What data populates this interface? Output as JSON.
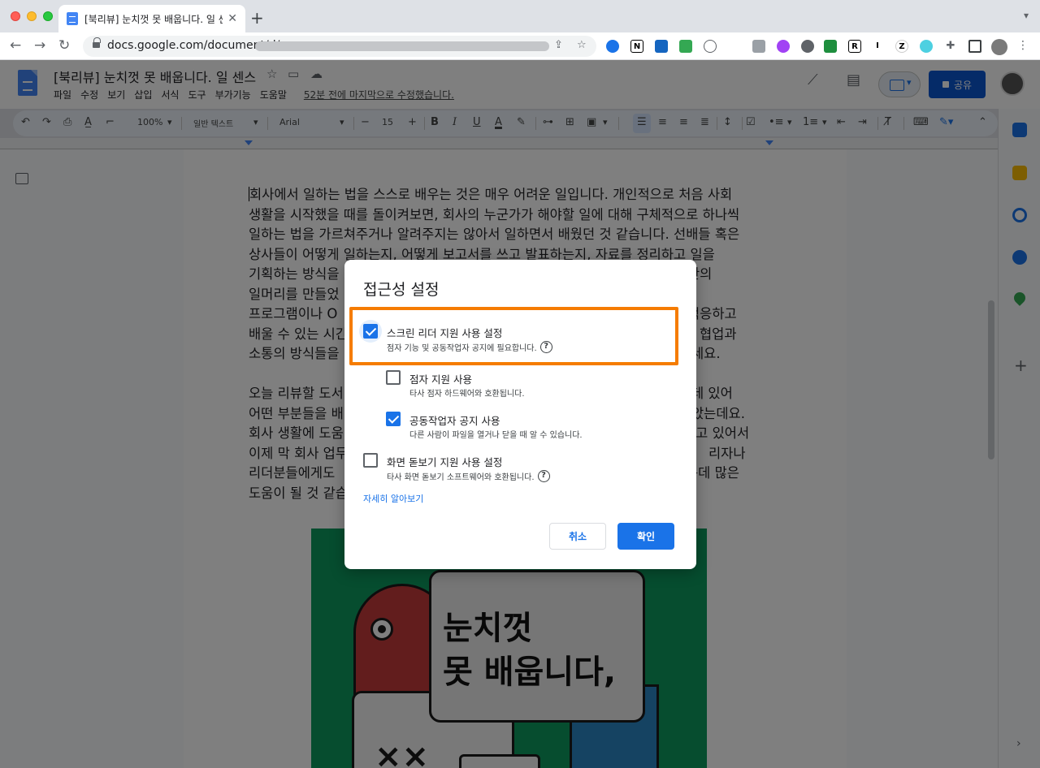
{
  "browser": {
    "tab_title": "[북리뷰] 눈치껏 못 배웁니다. 일 센스",
    "url": "docs.google.com/document/d/",
    "extensions": [
      "N",
      "R",
      "I",
      "Z"
    ]
  },
  "docs": {
    "title": "[북리뷰] 눈치껏 못 배웁니다. 일 센스",
    "menu": [
      "파일",
      "수정",
      "보기",
      "삽입",
      "서식",
      "도구",
      "부가기능",
      "도움말"
    ],
    "last_edit": "52분 전에 마지막으로 수정했습니다.",
    "share_label": "공유"
  },
  "format_toolbar": {
    "zoom": "100%",
    "style": "일반 텍스트",
    "font": "Arial",
    "font_size": "15",
    "bold": "B",
    "italic": "I",
    "underline": "U",
    "text_color": "A"
  },
  "document": {
    "paragraph1": [
      "회사에서 일하는 법을 스스로 배우는 것은 매우 어려운 일입니다. 개인적으로 처음 사회",
      "생활을 시작했을 때를 돌이켜보면, 회사의 누군가가 해야할 일에 대해 구체적으로 하나씩",
      "일하는 법을 가르쳐주거나 알려주지는 않아서 일하면서 배웠던 것 같습니다. 선배들 혹은",
      "상사들이 어떻게 일하는지, 어떻게 보고서를 쓰고 발표하는지, 자료를 정리하고 일을",
      "기획하는 방식을",
      "일머리를 만들었",
      "프로그램이나 O",
      "배울 수 있는 시간",
      "소통의 방식들을"
    ],
    "paragraph1_right": [
      "",
      "",
      "",
      "",
      "만의",
      "",
      "적응하고",
      "협업과",
      "세요."
    ],
    "paragraph2": [
      "오늘 리뷰할 도서",
      "어떤 부분들을 배",
      "회사 생활에 도움",
      "이제 막 회사 업무",
      "리더분들에게도",
      "도움이 될 것 같습"
    ],
    "paragraph2_right": [
      "데 있어",
      "았는데요.",
      "담고 있어서",
      "리자나",
      "는데 많은",
      ""
    ]
  },
  "book_cover": {
    "title_line1": "눈치껏",
    "title_line2": "못 배웁니다,",
    "marks": "××"
  },
  "dialog": {
    "title": "접근성 설정",
    "options": [
      {
        "label": "스크린 리더 지원 사용 설정",
        "desc": "점자 기능 및 공동작업자 공지에 필요합니다.",
        "checked": true,
        "help": true
      },
      {
        "label": "점자 지원 사용",
        "desc": "타사 점자 하드웨어와 호환됩니다.",
        "checked": false,
        "help": false
      },
      {
        "label": "공동작업자 공지 사용",
        "desc": "다른 사람이 파일을 열거나 닫을 때 알 수 있습니다.",
        "checked": true,
        "help": false
      },
      {
        "label": "화면 돋보기 지원 사용 설정",
        "desc": "타사 화면 돋보기 소프트웨어와 호환됩니다.",
        "checked": false,
        "help": true
      }
    ],
    "learn_more": "자세히 알아보기",
    "cancel": "취소",
    "ok": "확인",
    "help_glyph": "?"
  },
  "colors": {
    "accent": "#1a73e8",
    "highlight": "#f57c00",
    "share": "#0b57d0",
    "book_green": "#0d9a5f"
  }
}
